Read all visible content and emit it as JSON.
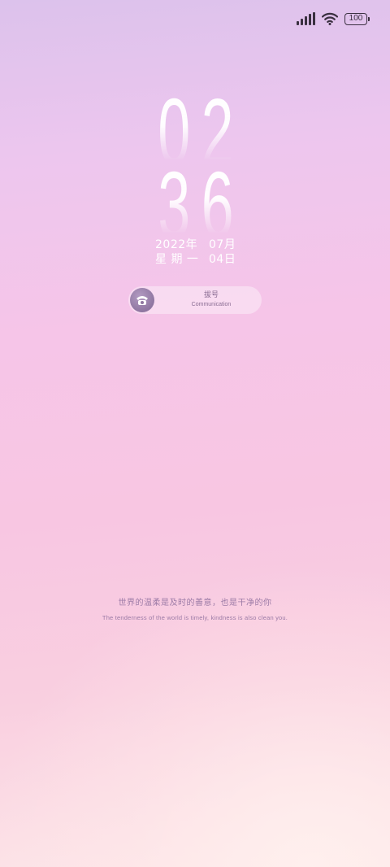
{
  "status_bar": {
    "signal": "signal-icon",
    "wifi": "wifi-icon",
    "battery_level": "100",
    "icon_color": "#3a3040"
  },
  "clock": {
    "hours": [
      "0",
      "2"
    ],
    "minutes": [
      "3",
      "6"
    ]
  },
  "date": {
    "year": "2022年",
    "month": "07月",
    "weekday": "星 期 一",
    "day": "04日"
  },
  "dial_widget": {
    "icon": "phone-icon",
    "label": "拔号",
    "sublabel": "Communication"
  },
  "quote": {
    "chinese": "世界的温柔是及时的善意，也是干净的你",
    "english": "The tenderness of the world is timely, kindness is also clean you."
  },
  "colors": {
    "gradient_top": "#dcc2ec",
    "gradient_mid": "#f6c5e8",
    "gradient_bottom": "#fde6e8",
    "accent_text": "#9b7aa6",
    "icon_purple": "#8f76a1"
  }
}
